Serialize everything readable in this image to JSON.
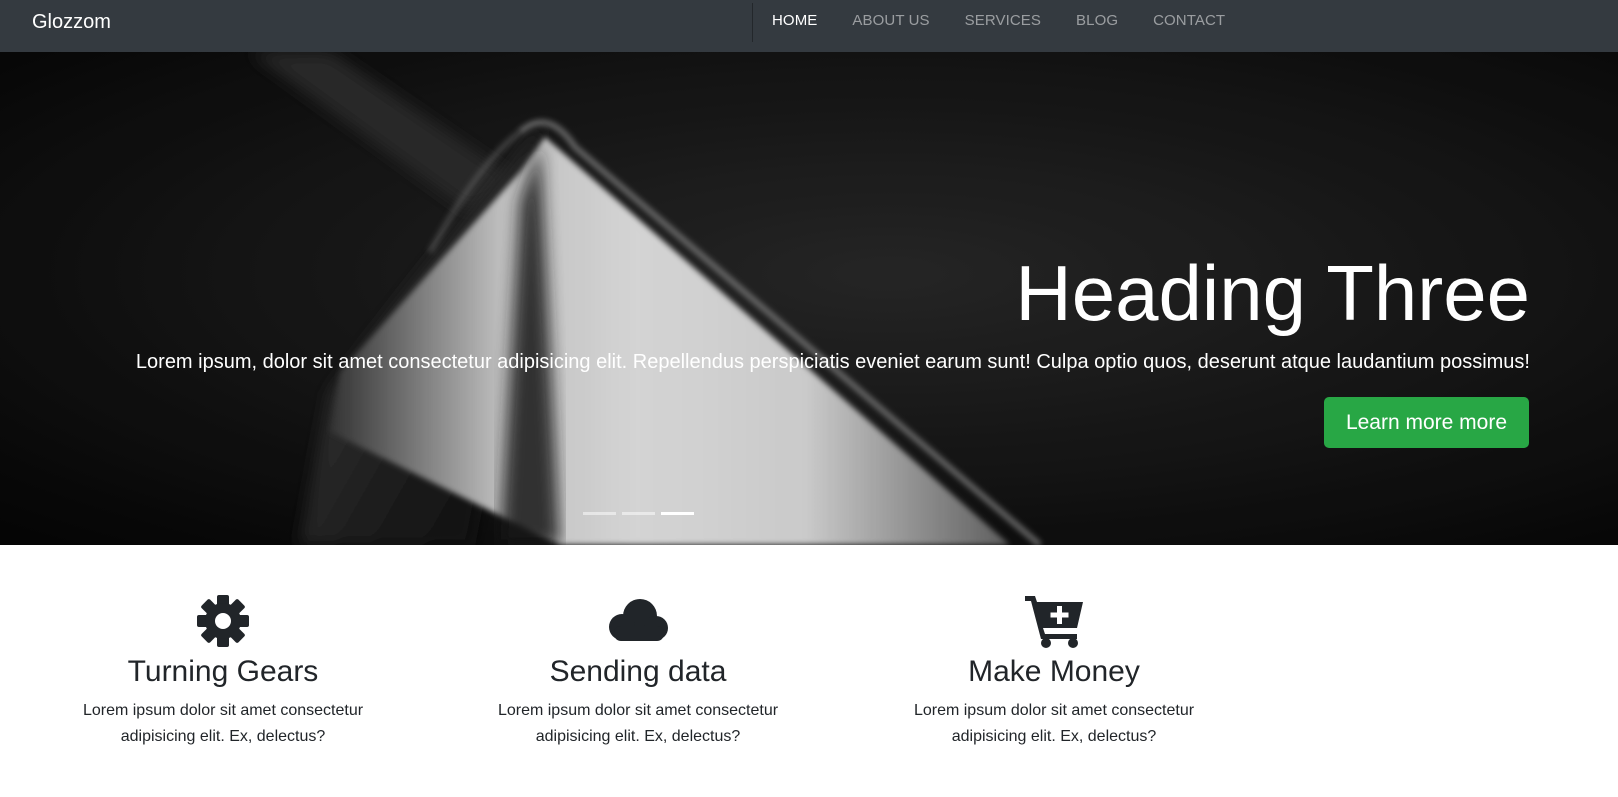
{
  "navbar": {
    "brand": "Glozzom",
    "links": [
      {
        "label": "HOME",
        "active": true
      },
      {
        "label": "ABOUT US",
        "active": false
      },
      {
        "label": "SERVICES",
        "active": false
      },
      {
        "label": "BLOG",
        "active": false
      },
      {
        "label": "CONTACT",
        "active": false
      }
    ]
  },
  "hero": {
    "heading": "Heading Three",
    "text": "Lorem ipsum, dolor sit amet consectetur adipisicing elit. Repellendus perspiciatis eveniet earum sunt! Culpa optio quos, deserunt atque laudantium possimus!",
    "button_label": "Learn more more",
    "slides": 3,
    "active_slide": 3
  },
  "features": [
    {
      "icon": "gear-icon",
      "title": "Turning Gears",
      "text": "Lorem ipsum dolor sit amet consectetur adipisicing elit. Ex, delectus?"
    },
    {
      "icon": "cloud-icon",
      "title": "Sending data",
      "text": "Lorem ipsum dolor sit amet consectetur adipisicing elit. Ex, delectus?"
    },
    {
      "icon": "cart-plus-icon",
      "title": "Make Money",
      "text": "Lorem ipsum dolor sit amet consectetur adipisicing elit. Ex, delectus?"
    }
  ],
  "colors": {
    "navbar_bg": "#343a40",
    "button_success": "#28a745",
    "text_dark": "#212529"
  }
}
